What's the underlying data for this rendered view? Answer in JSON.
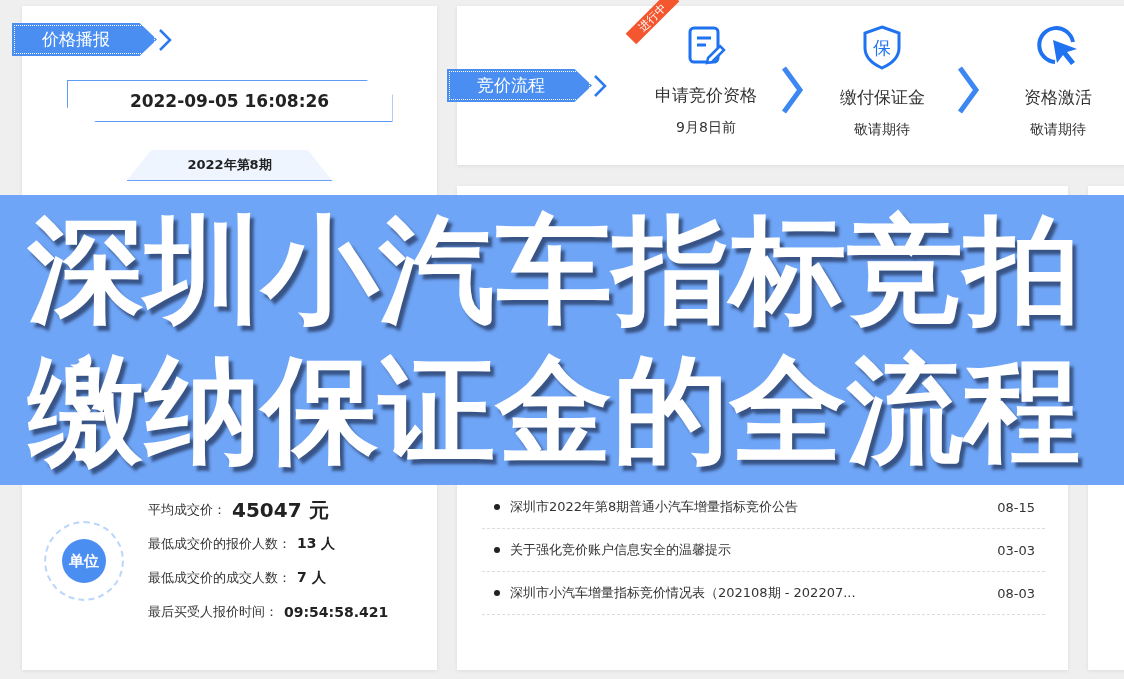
{
  "price_report": {
    "header": "价格播报",
    "datetime": "2022-09-05 16:08:26",
    "period": "2022年第8期",
    "unit_badge": "单位",
    "stats": [
      {
        "label": "平均成交价：",
        "value": "45047 元",
        "large": true
      },
      {
        "label": "最低成交价的报价人数：",
        "value": "13 人",
        "large": false
      },
      {
        "label": "最低成交价的成交人数：",
        "value": "7 人",
        "large": false
      },
      {
        "label": "最后买受人报价时间：",
        "value": "09:54:58.421",
        "large": false
      }
    ]
  },
  "bidding_process": {
    "header": "竞价流程",
    "steps": [
      {
        "kind": "form",
        "title": "申请竞价资格",
        "note": "9月8日前",
        "status_tag": "进行中"
      },
      {
        "kind": "shield",
        "title": "缴付保证金",
        "note": "敬请期待",
        "icon_label": "保"
      },
      {
        "kind": "cursor",
        "title": "资格激活",
        "note": "敬请期待"
      }
    ]
  },
  "announcements": [
    {
      "title": "深圳市2022年第8期普通小汽车增量指标竞价公告",
      "date": "08-15"
    },
    {
      "title": "关于强化竞价账户信息安全的温馨提示",
      "date": "03-03"
    },
    {
      "title": "深圳市小汽车增量指标竞价情况表（202108期 - 202207...",
      "date": "08-03"
    }
  ],
  "banner": {
    "lines": [
      "深圳小汽车指标竞拍",
      "缴纳保证金的全流程"
    ]
  }
}
